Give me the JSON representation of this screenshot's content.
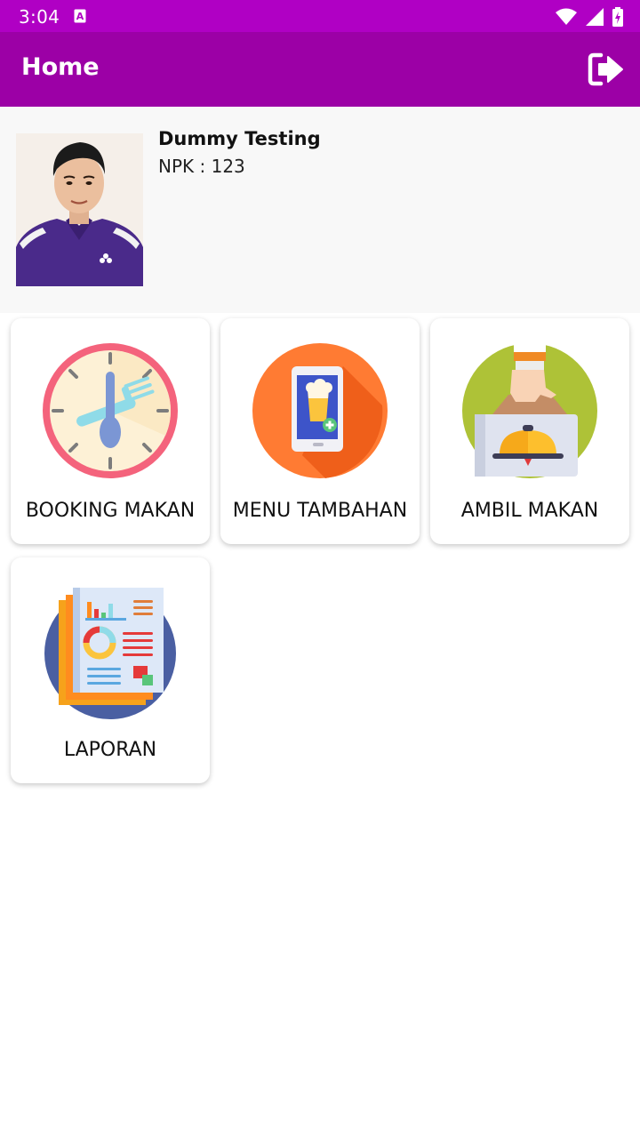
{
  "status_bar": {
    "time": "3:04",
    "icons": [
      "notification-a-icon",
      "wifi-icon",
      "signal-icon",
      "battery-charging-icon"
    ]
  },
  "app_bar": {
    "title": "Home",
    "action_icon": "logout-icon",
    "color": "#9c00a6"
  },
  "profile": {
    "name": "Dummy Testing",
    "npk": "NPK : 123"
  },
  "menu": {
    "items": [
      {
        "label": "BOOKING MAKAN",
        "icon": "clock-fork-spoon-icon"
      },
      {
        "label": "MENU TAMBAHAN",
        "icon": "phone-drink-add-icon"
      },
      {
        "label": "AMBIL MAKAN",
        "icon": "hand-food-delivery-icon"
      },
      {
        "label": "LAPORAN",
        "icon": "report-document-icon"
      }
    ]
  },
  "colors": {
    "status_bar": "#b000c4",
    "app_bar": "#9c00a6",
    "profile_bg": "#f8f8f8"
  }
}
